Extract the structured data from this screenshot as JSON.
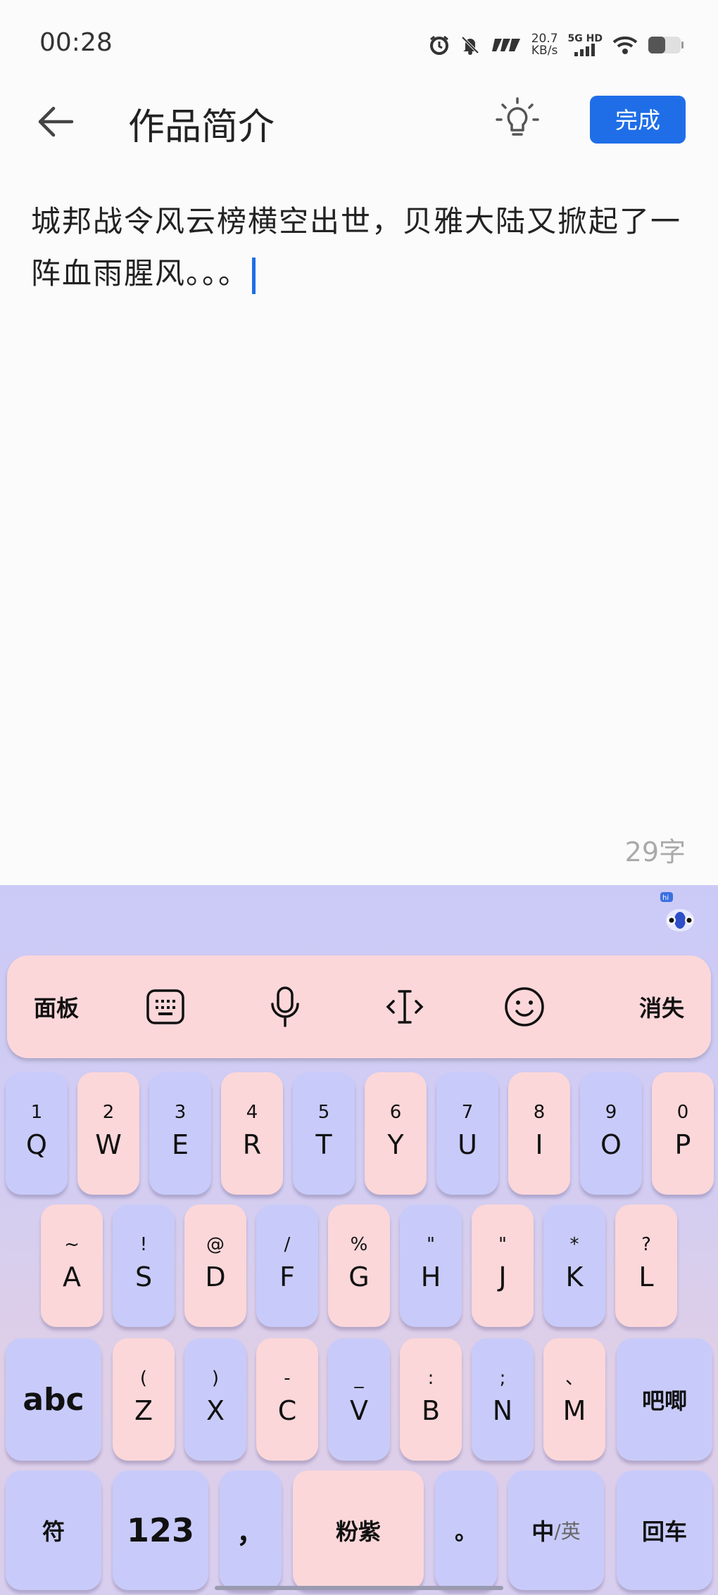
{
  "status_bar": {
    "time": "00:28",
    "speed_value": "20.7",
    "speed_unit": "KB/s",
    "network": "5G HD"
  },
  "header": {
    "title": "作品简介",
    "done_label": "完成"
  },
  "editor": {
    "text": "城邦战令风云榜横空出世，贝雅大陆又掀起了一阵血雨腥风。。。",
    "char_count": "29字"
  },
  "keyboard": {
    "toolbar": {
      "panel_label": "面板",
      "hide_label": "消失"
    },
    "row1": [
      {
        "sub": "1",
        "main": "Q"
      },
      {
        "sub": "2",
        "main": "W"
      },
      {
        "sub": "3",
        "main": "E"
      },
      {
        "sub": "4",
        "main": "R"
      },
      {
        "sub": "5",
        "main": "T"
      },
      {
        "sub": "6",
        "main": "Y"
      },
      {
        "sub": "7",
        "main": "U"
      },
      {
        "sub": "8",
        "main": "I"
      },
      {
        "sub": "9",
        "main": "O"
      },
      {
        "sub": "0",
        "main": "P"
      }
    ],
    "row2": [
      {
        "sub": "~",
        "main": "A"
      },
      {
        "sub": "!",
        "main": "S"
      },
      {
        "sub": "@",
        "main": "D"
      },
      {
        "sub": "/",
        "main": "F"
      },
      {
        "sub": "%",
        "main": "G"
      },
      {
        "sub": "\"",
        "main": "H"
      },
      {
        "sub": "\"",
        "main": "J"
      },
      {
        "sub": "*",
        "main": "K"
      },
      {
        "sub": "?",
        "main": "L"
      }
    ],
    "row3": [
      {
        "sub": "(",
        "main": "Z"
      },
      {
        "sub": ")",
        "main": "X"
      },
      {
        "sub": "-",
        "main": "C"
      },
      {
        "sub": "_",
        "main": "V"
      },
      {
        "sub": ":",
        "main": "B"
      },
      {
        "sub": ";",
        "main": "N"
      },
      {
        "sub": "、",
        "main": "M"
      }
    ],
    "abc_label": "abc",
    "ba_label": "吧唧",
    "symbol_label": "符",
    "num_label": "123",
    "comma_label": "，",
    "space_label": "粉紫",
    "period_label": "。",
    "lang_main": "中",
    "lang_sub": "/英",
    "enter_label": "回车"
  }
}
